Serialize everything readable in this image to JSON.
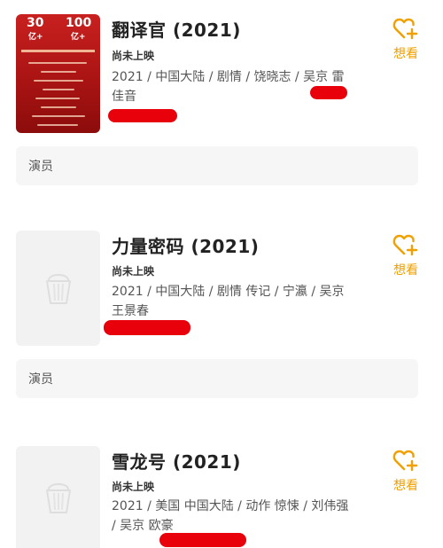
{
  "colors": {
    "accent": "#f0a000",
    "redline": "#e8000b"
  },
  "items": [
    {
      "title": "翻译官 (2021)",
      "status": "尚未上映",
      "meta": "2021 / 中国大陆 / 剧情 / 饶晓志 / 吴京 雷佳音",
      "want_label": "想看",
      "poster": {
        "type": "red",
        "badge_left_big": "30",
        "badge_left_small": "亿+",
        "badge_right_big": "100",
        "badge_right_small": "亿+"
      }
    },
    {
      "title": "力量密码 (2021)",
      "status": "尚未上映",
      "meta": "2021 / 中国大陆 / 剧情 传记 / 宁瀛 / 吴京 王景春",
      "want_label": "想看",
      "poster": {
        "type": "placeholder"
      }
    },
    {
      "title": "雪龙号 (2021)",
      "status": "尚未上映",
      "meta": "2021 / 美国 中国大陆 / 动作 惊悚 / 刘伟强 / 吴京 欧豪",
      "want_label": "想看",
      "poster": {
        "type": "placeholder"
      }
    }
  ],
  "cast_bars": [
    {
      "label": "演员"
    },
    {
      "label": "演员"
    }
  ]
}
